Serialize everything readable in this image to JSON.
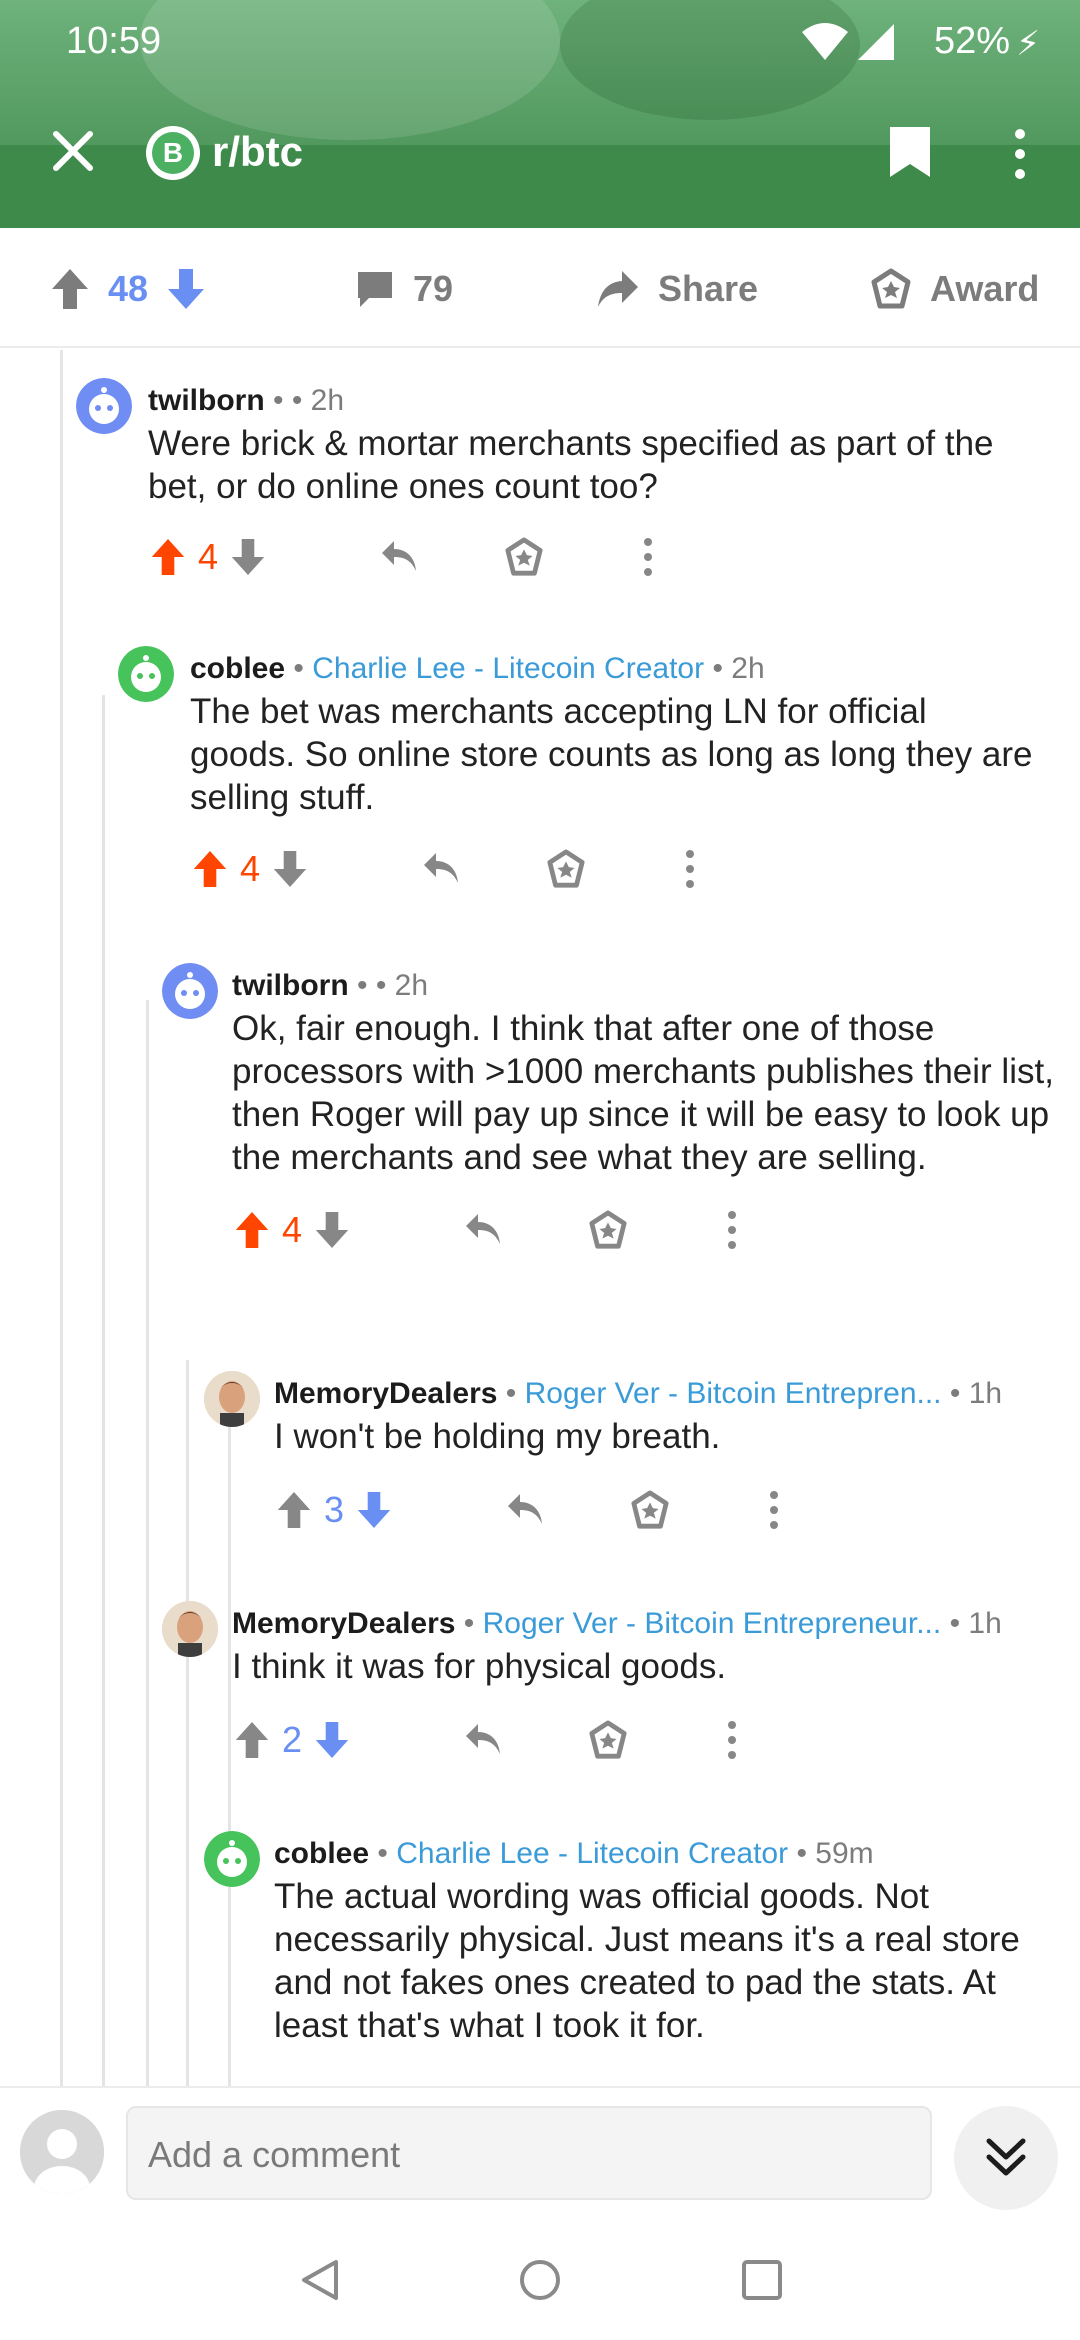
{
  "status_bar": {
    "time": "10:59",
    "battery": "52%"
  },
  "nav": {
    "subreddit": "r/btc",
    "subreddit_icon_letter": "B"
  },
  "post_actions": {
    "score": "48",
    "comments": "79",
    "share": "Share",
    "award": "Award"
  },
  "comments": [
    {
      "user": "twilborn",
      "flair": "",
      "sep": " • ",
      "age": "• 2h",
      "body": "Were brick & mortar merchants specified as part of the bet, or do online ones count too?",
      "score": "4",
      "vote": "up"
    },
    {
      "user": "coblee",
      "flair": "Charlie Lee - Litecoin Creator",
      "sep": " • ",
      "age": "• 2h",
      "body": "The bet was merchants accepting LN for official goods. So online store counts as long as long they are selling stuff.",
      "score": "4",
      "vote": "up"
    },
    {
      "user": "twilborn",
      "flair": "",
      "sep": " • ",
      "age": "• 2h",
      "body": "Ok, fair enough.  I think that after one of those processors with >1000 merchants publishes their list, then Roger will pay up since it will be easy to look up the merchants and see what they are selling.",
      "score": "4",
      "vote": "up"
    },
    {
      "user": "MemoryDealers",
      "flair": "Roger Ver - Bitcoin Entrepren...",
      "sep": " • ",
      "age": "• 1h",
      "body": "I won't be holding my breath.",
      "score": "3",
      "vote": "none"
    },
    {
      "user": "MemoryDealers",
      "flair": "Roger Ver - Bitcoin Entrepreneur...",
      "sep": " • ",
      "age": "• 1h",
      "body": "I think it was for physical goods.",
      "score": "2",
      "vote": "none"
    },
    {
      "user": "coblee",
      "flair": "Charlie Lee - Litecoin Creator",
      "sep": " • ",
      "age": "• 59m",
      "body": "The actual wording was official goods. Not necessarily physical. Just means it's a real store and not fakes ones created to pad the stats. At least that's what I took it for.",
      "score": "",
      "vote": "none"
    }
  ],
  "composer": {
    "placeholder": "Add a comment"
  },
  "colors": {
    "upvote": "#ff4500",
    "downvote": "#6a8ff2",
    "flair": "#3a9bd8",
    "header": "#3d8a4b"
  }
}
